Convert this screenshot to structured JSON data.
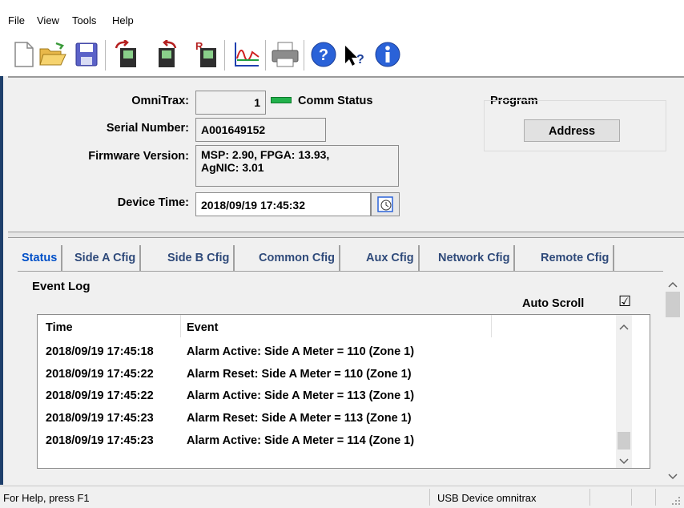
{
  "menu": [
    "File",
    "View",
    "Tools",
    "Help"
  ],
  "toolbar": {
    "buttons": [
      "new-file",
      "open-folder",
      "save",
      "read-device",
      "write-device",
      "reset-device",
      "chart",
      "print",
      "help",
      "context-help",
      "about"
    ]
  },
  "device": {
    "omnitrax_label": "OmniTrax:",
    "omnitrax_value": "1",
    "comm_status_label": "Comm Status",
    "comm_status_color": "#22b14c",
    "serial_label": "Serial Number:",
    "serial_value": "A001649152",
    "firmware_label": "Firmware Version:",
    "firmware_line1": "MSP: 2.90, FPGA: 13.93,",
    "firmware_line2": "AgNIC: 3.01",
    "time_label": "Device Time:",
    "time_value": "2018/09/19 17:45:32"
  },
  "program": {
    "label": "Program",
    "address_button": "Address"
  },
  "tabs": [
    "Status",
    "Side A Cfig",
    "Side B Cfig",
    "Common Cfig",
    "Aux Cfig",
    "Network Cfig",
    "Remote Cfig"
  ],
  "active_tab": "Status",
  "event_log": {
    "title": "Event Log",
    "auto_scroll_label": "Auto Scroll",
    "auto_scroll_checked": "☑",
    "columns": [
      "Time",
      "Event"
    ],
    "rows": [
      {
        "time": "2018/09/19 17:45:18",
        "event": "Alarm Active: Side A Meter = 110 (Zone 1)"
      },
      {
        "time": "2018/09/19 17:45:22",
        "event": "Alarm Reset: Side A Meter = 110 (Zone 1)"
      },
      {
        "time": "2018/09/19 17:45:22",
        "event": "Alarm Active: Side A Meter = 113 (Zone 1)"
      },
      {
        "time": "2018/09/19 17:45:23",
        "event": "Alarm Reset: Side A Meter = 113 (Zone 1)"
      },
      {
        "time": "2018/09/19 17:45:23",
        "event": "Alarm Active: Side A Meter = 114 (Zone 1)"
      }
    ]
  },
  "statusbar": {
    "help_text": "For Help, press F1",
    "device_text": "USB Device omnitrax"
  }
}
